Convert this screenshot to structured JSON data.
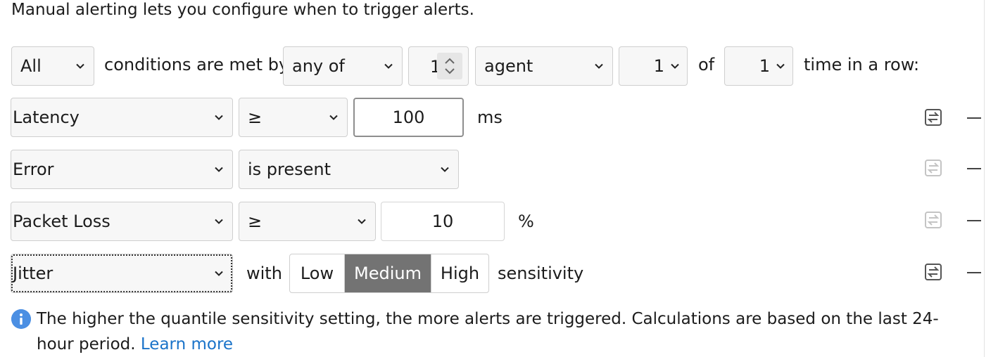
{
  "intro": "Manual alerting lets you configure when to trigger alerts.",
  "condition_row": {
    "match_select": "All",
    "conditions_text": "conditions are met by",
    "scope_select": "any of",
    "count_value": "1",
    "target_select": "agent",
    "times_select": "1",
    "of_text": "of",
    "rounds_select": "1",
    "suffix_text": "time in a row:"
  },
  "rules": [
    {
      "metric": "Latency",
      "operator": "≥",
      "value": "100",
      "unit": "ms"
    },
    {
      "metric": "Error",
      "operator": "is present"
    },
    {
      "metric": "Packet Loss",
      "operator": "≥",
      "value": "10",
      "unit": "%"
    },
    {
      "metric": "Jitter",
      "with_text": "with",
      "sensitivity_options": [
        "Low",
        "Medium",
        "High"
      ],
      "selected": "Medium",
      "sensitivity_text": "sensitivity"
    }
  ],
  "info": {
    "text": "The higher the quantile sensitivity setting, the more alerts are triggered. Calculations are based on the last 24-hour period.",
    "link": "Learn more"
  },
  "colors": {
    "selected_segment": "#737373",
    "link": "#1a73c9",
    "info_icon": "#4b8fe3"
  }
}
